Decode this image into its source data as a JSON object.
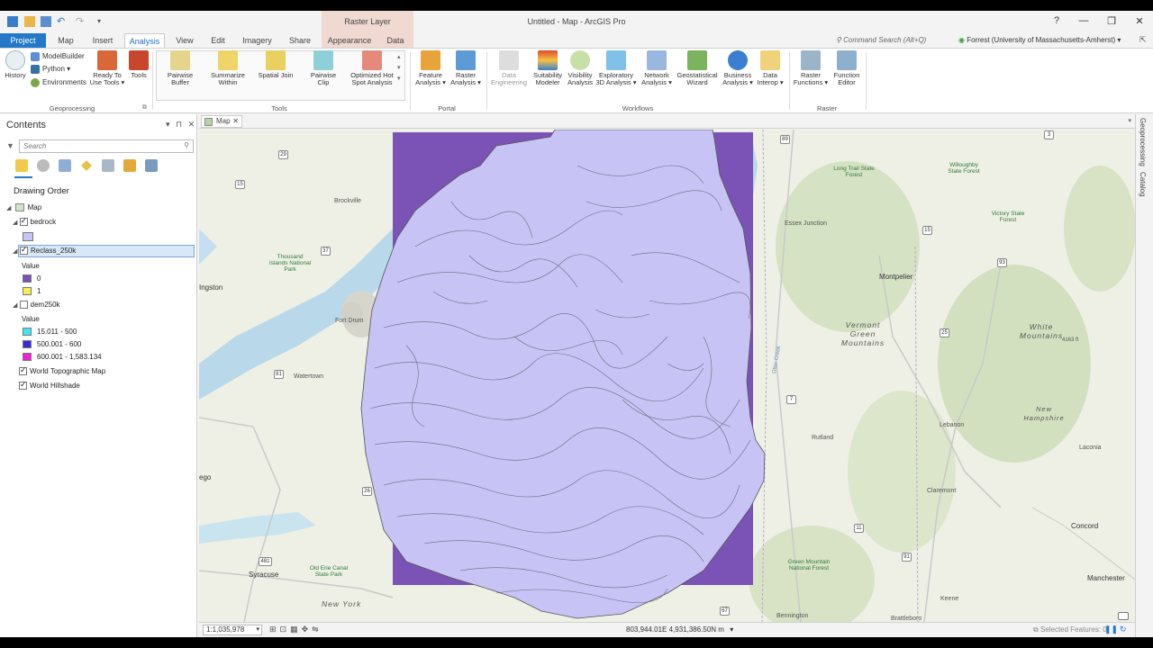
{
  "window": {
    "title": "Untitled - Map - ArcGIS Pro",
    "context_tab_title": "Raster Layer",
    "help": "?",
    "min": "—",
    "max": "❐",
    "close": "✕"
  },
  "tabs": [
    "Project",
    "Map",
    "Insert",
    "Analysis",
    "View",
    "Edit",
    "Imagery",
    "Share",
    "Appearance",
    "Data"
  ],
  "command_search": {
    "placeholder": "Command Search (Alt+Q)"
  },
  "user": "Forrest (University of Massachusetts-Amherst) ▾",
  "ribbon": {
    "geoprocessing": {
      "label": "Geoprocessing",
      "history": "History",
      "modelbuilder": "ModelBuilder",
      "python": "Python ▾",
      "environments": "Environments",
      "ready_to_use": "Ready To Use Tools ▾",
      "tools": "Tools"
    },
    "tools_group": {
      "label": "Tools",
      "items": [
        "Pairwise Buffer",
        "Summarize Within",
        "Spatial Join",
        "Pairwise Clip",
        "Optimized Hot Spot Analysis"
      ]
    },
    "portal": {
      "label": "Portal",
      "items": [
        "Feature Analysis ▾",
        "Raster Analysis ▾"
      ]
    },
    "workflows": {
      "label": "Workflows",
      "items": [
        "Data Engineering",
        "Suitability Modeler",
        "Visibility Analysis",
        "Exploratory 3D Analysis ▾",
        "Network Analysis ▾",
        "Geostatistical Wizard",
        "Business Analysis ▾",
        "Data Interop ▾"
      ]
    },
    "raster": {
      "label": "Raster",
      "items": [
        "Raster Functions ▾",
        "Function Editor"
      ]
    }
  },
  "contents": {
    "title": "Contents",
    "search_placeholder": "Search",
    "drawing_order": "Drawing Order",
    "map_node": "Map",
    "layers": {
      "bedrock": "bedrock",
      "reclass": "Reclass_250k",
      "reclass_field": "Value",
      "reclass_classes": [
        {
          "label": "0",
          "color": "#7b52b5"
        },
        {
          "label": "1",
          "color": "#f5ef5a"
        }
      ],
      "dem": "dem250k",
      "dem_field": "Value",
      "dem_classes": [
        {
          "label": "15.011 - 500",
          "color": "#3fe8f0"
        },
        {
          "label": "500.001 - 600",
          "color": "#3a2ad9"
        },
        {
          "label": "600.001 - 1,583.134",
          "color": "#f21fd6"
        }
      ],
      "topo": "World Topographic Map",
      "hillshade": "World Hillshade"
    }
  },
  "map_tab": "Map",
  "right_tabs": [
    "Geoprocessing",
    "Catalog"
  ],
  "status": {
    "scale": "1:1,035,978",
    "coords": "803,944.01E 4,931,386.50N m",
    "selected": "Selected Features: 0"
  },
  "colors": {
    "accent": "#2478c8",
    "bedrock_fill": "#c7c3f5",
    "reclass_fill": "#7b52b5",
    "context_tab": "#efd9d1"
  },
  "map_labels": {
    "cities": [
      "Brockville",
      "Ingston",
      "Watertown",
      "Syracuse",
      "Montpelier",
      "Essex Junction",
      "Rutland",
      "Lebanon",
      "Claremont",
      "Concord",
      "Manchester",
      "Keene",
      "Brattleboro",
      "Bennington",
      "Laconia",
      "Fort Drum",
      "ego"
    ],
    "regions": [
      "Vermont Green Mountains",
      "White Mountains",
      "New Hampshire",
      "New York"
    ],
    "parks": [
      "Thousand Islands National Park",
      "Long Trail State Forest",
      "Willoughby State Forest",
      "Victory State Forest",
      "Green Mountain National Forest",
      "Old Erie Canal State Park"
    ],
    "routes": [
      "29",
      "15",
      "37",
      "81",
      "26",
      "481",
      "89",
      "3",
      "7",
      "91",
      "93",
      "11",
      "67",
      "15",
      "25",
      "4163 ft",
      "Otter Creek"
    ]
  }
}
